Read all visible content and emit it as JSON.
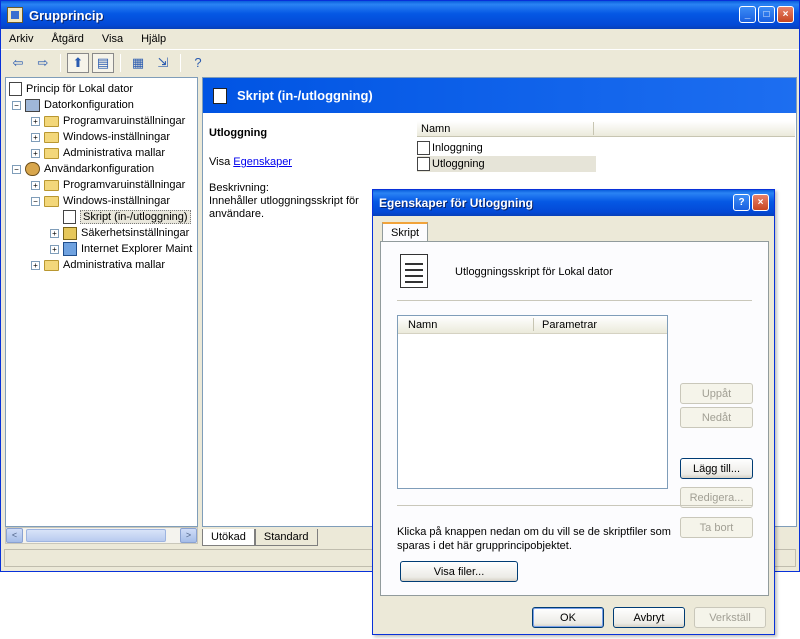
{
  "window": {
    "title": "Grupprincip",
    "controls": [
      "_",
      "□",
      "×"
    ]
  },
  "menu": {
    "items": [
      "Arkiv",
      "Åtgärd",
      "Visa",
      "Hjälp"
    ]
  },
  "toolbar": {
    "back": "⇦",
    "forward": "⇨",
    "up": "⬆",
    "show_tree": "▤",
    "properties": "▦",
    "export": "⇲",
    "help": "?"
  },
  "tree": {
    "root": "Princip för Lokal dator",
    "computer_config": "Datorkonfiguration",
    "cc_software": "Programvaruinställningar",
    "cc_windows": "Windows-inställningar",
    "cc_admin": "Administrativa mallar",
    "user_config": "Användarkonfiguration",
    "uc_software": "Programvaruinställningar",
    "uc_windows": "Windows-inställningar",
    "uc_scripts": "Skript (in-/utloggning)",
    "uc_security": "Säkerhetsinställningar",
    "uc_ie": "Internet Explorer Maint",
    "uc_admin": "Administrativa mallar",
    "plus": "+",
    "minus": "−"
  },
  "right_pane": {
    "header": "Skript (in-/utloggning)",
    "detail_title": "Utloggning",
    "show_prefix": "Visa",
    "show_link": "Egenskaper",
    "description": "Beskrivning:\nInnehåller utloggningsskript för användare.",
    "column_name": "Namn",
    "items": [
      "Inloggning",
      "Utloggning"
    ]
  },
  "bottom_tabs": [
    "Utökad",
    "Standard"
  ],
  "scroll": {
    "left": "<",
    "right": ">",
    "grip": "|||"
  },
  "dialog": {
    "title": "Egenskaper för Utloggning",
    "help_btn": "?",
    "close_btn": "×",
    "tab": "Skript",
    "description": "Utloggningsskript för Lokal dator",
    "col_name": "Namn",
    "col_params": "Parametrar",
    "btn_up": "Uppåt",
    "btn_down": "Nedåt",
    "btn_add": "Lägg till...",
    "btn_edit": "Redigera...",
    "btn_remove": "Ta bort",
    "footer_text": "Klicka på knappen nedan om du vill se de skriptfiler som sparas i det här grupprincipobjektet.",
    "btn_show_files": "Visa filer...",
    "btn_ok": "OK",
    "btn_cancel": "Avbryt",
    "btn_apply": "Verkställ"
  }
}
